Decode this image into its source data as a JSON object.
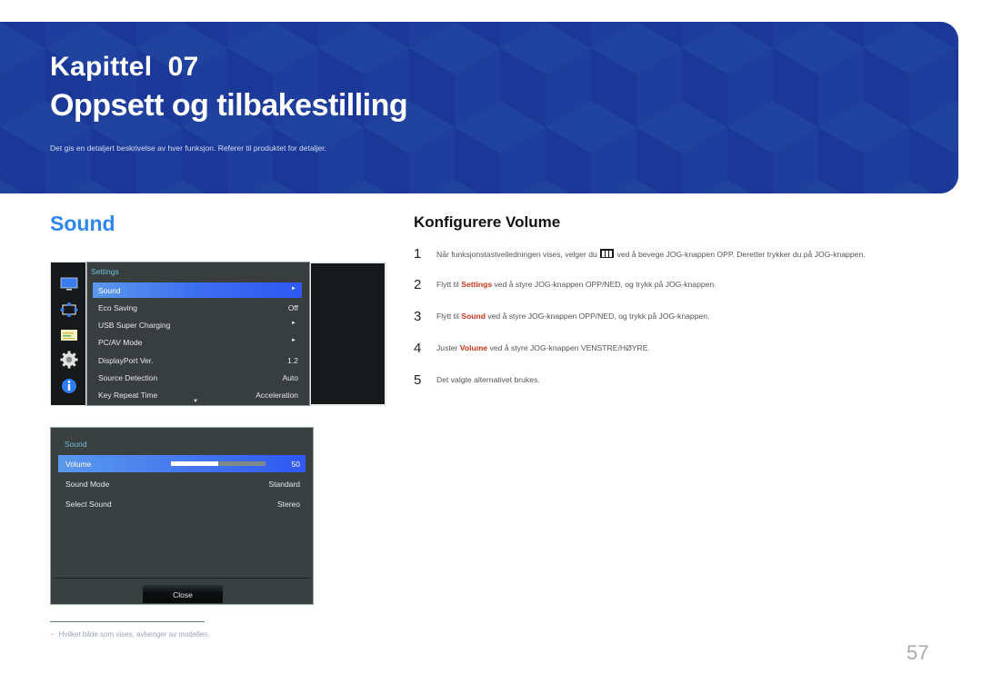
{
  "banner": {
    "chapter_label": "Kapittel  07",
    "title": "Oppsett og tilbakestilling",
    "description": "Det gis en detaljert beskrivelse av hver funksjon. Referer til produktet for detaljer.",
    "bg_color": "#1f3c99"
  },
  "section": {
    "title": "Sound",
    "color": "#2e86f0"
  },
  "settings_osd": {
    "sidebar_icons": [
      "picture-icon",
      "onscreen-display-icon",
      "system-icon",
      "settings-gear-icon",
      "information-icon"
    ],
    "title": "Settings",
    "items": [
      {
        "label": "Sound",
        "value": "",
        "arrow": "►",
        "selected": true
      },
      {
        "label": "Eco Saving",
        "value": "Off",
        "arrow": "",
        "selected": false
      },
      {
        "label": "USB Super Charging",
        "value": "",
        "arrow": "►",
        "selected": false
      },
      {
        "label": "PC/AV Mode",
        "value": "",
        "arrow": "►",
        "selected": false
      },
      {
        "label": "DisplayPort Ver.",
        "value": "1.2",
        "arrow": "",
        "selected": false
      },
      {
        "label": "Source Detection",
        "value": "Auto",
        "arrow": "",
        "selected": false
      },
      {
        "label": "Key Repeat Time",
        "value": "Acceleration",
        "arrow": "",
        "selected": false
      }
    ],
    "scroll_indicator": "▼"
  },
  "sound_osd": {
    "title": "Sound",
    "items": [
      {
        "label": "Volume",
        "value": "50",
        "selected": true,
        "slider_fraction": 0.5
      },
      {
        "label": "Sound Mode",
        "value": "Standard",
        "selected": false
      },
      {
        "label": "Select Sound",
        "value": "Stereo",
        "selected": false
      }
    ],
    "close_label": "Close"
  },
  "footnote": {
    "dash": "−",
    "text": "Hvilket bilde som vises, avhenger av modellen."
  },
  "instructions": {
    "title": "Konfigurere Volume",
    "highlight_color": "#c8361a",
    "steps": [
      {
        "num": "1",
        "before": "Når funksjonstastveiledningen vises, velger du ",
        "icon": "menu-icon",
        "after": " ved å bevege JOG-knappen OPP. Deretter trykker du på JOG-knappen."
      },
      {
        "num": "2",
        "before": "Flytt til ",
        "highlight": "Settings",
        "after": " ved å styre JOG-knappen OPP/NED, og trykk på JOG-knappen."
      },
      {
        "num": "3",
        "before": "Flytt til ",
        "highlight": "Sound",
        "after": " ved å styre JOG-knappen OPP/NED, og trykk på JOG-knappen."
      },
      {
        "num": "4",
        "before": "Juster ",
        "highlight": "Volume",
        "after": " ved å styre JOG-knappen VENSTRE/HØYRE."
      },
      {
        "num": "5",
        "before": "Det valgte alternativet brukes.",
        "highlight": "",
        "after": ""
      }
    ]
  },
  "page_number": "57"
}
